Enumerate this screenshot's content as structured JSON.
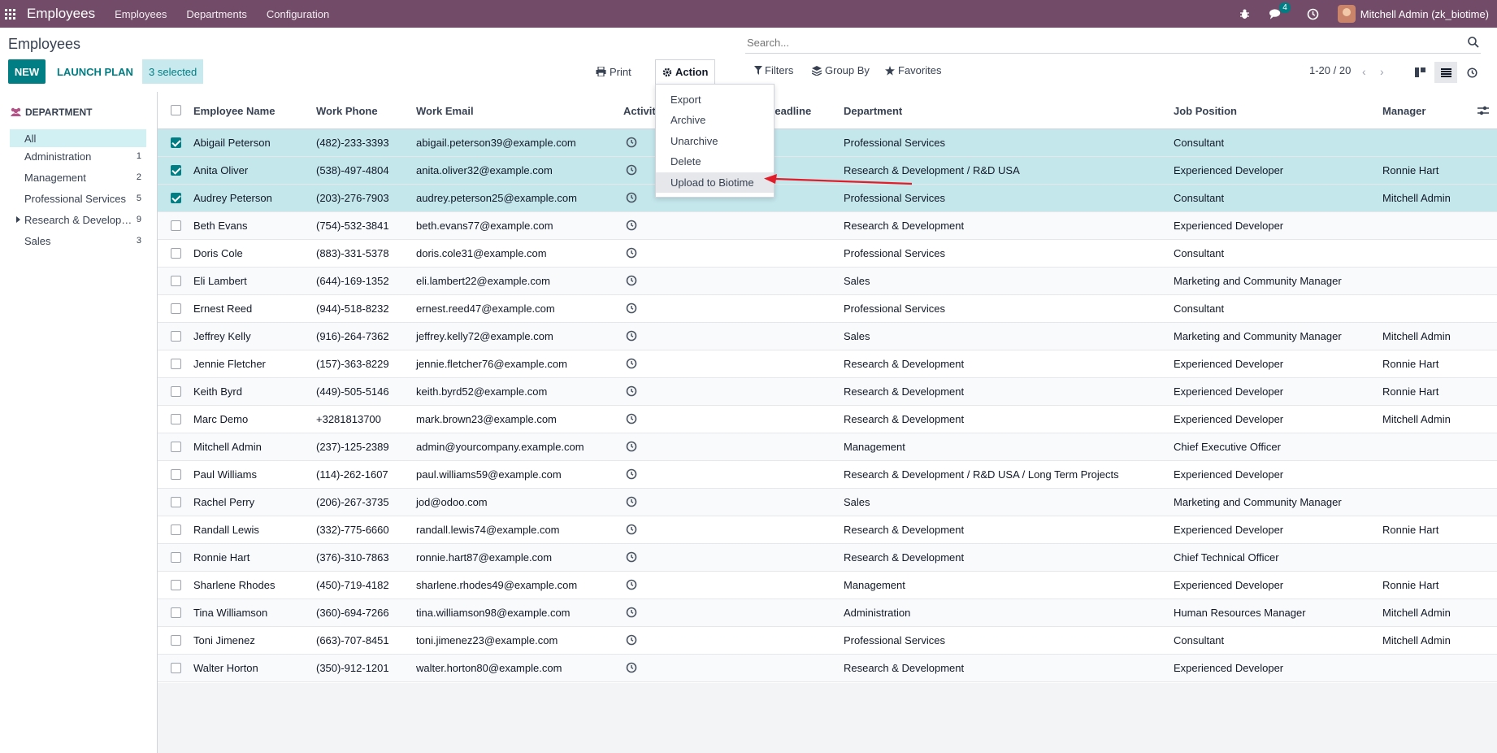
{
  "navbar": {
    "brand": "Employees",
    "menus": [
      "Employees",
      "Departments",
      "Configuration"
    ],
    "message_count": "4",
    "user": "Mitchell Admin (zk_biotime)"
  },
  "control": {
    "title": "Employees",
    "new_label": "NEW",
    "launch_label": "LAUNCH PLAN",
    "selected_label": "3 selected",
    "print_label": "Print",
    "action_label": "Action",
    "search_placeholder": "Search...",
    "filters_label": "Filters",
    "groupby_label": "Group By",
    "favorites_label": "Favorites",
    "pager": "1-20 / 20"
  },
  "action_menu": [
    "Export",
    "Archive",
    "Unarchive",
    "Delete",
    "Upload to Biotime"
  ],
  "sidebar": {
    "title": "DEPARTMENT",
    "items": [
      {
        "label": "All",
        "count": ""
      },
      {
        "label": "Administration",
        "count": "1"
      },
      {
        "label": "Management",
        "count": "2"
      },
      {
        "label": "Professional Services",
        "count": "5"
      },
      {
        "label": "Research & Development",
        "count": "9"
      },
      {
        "label": "Sales",
        "count": "3"
      }
    ]
  },
  "columns": [
    "Employee Name",
    "Work Phone",
    "Work Email",
    "Activities",
    "Deadline",
    "Department",
    "Job Position",
    "Manager"
  ],
  "rows": [
    {
      "name": "Abigail Peterson",
      "phone": "(482)-233-3393",
      "email": "abigail.peterson39@example.com",
      "dept": "Professional Services",
      "job": "Consultant",
      "manager": "",
      "selected": true
    },
    {
      "name": "Anita Oliver",
      "phone": "(538)-497-4804",
      "email": "anita.oliver32@example.com",
      "dept": "Research & Development / R&D USA",
      "job": "Experienced Developer",
      "manager": "Ronnie Hart",
      "selected": true
    },
    {
      "name": "Audrey Peterson",
      "phone": "(203)-276-7903",
      "email": "audrey.peterson25@example.com",
      "dept": "Professional Services",
      "job": "Consultant",
      "manager": "Mitchell Admin",
      "selected": true
    },
    {
      "name": "Beth Evans",
      "phone": "(754)-532-3841",
      "email": "beth.evans77@example.com",
      "dept": "Research & Development",
      "job": "Experienced Developer",
      "manager": "",
      "selected": false
    },
    {
      "name": "Doris Cole",
      "phone": "(883)-331-5378",
      "email": "doris.cole31@example.com",
      "dept": "Professional Services",
      "job": "Consultant",
      "manager": "",
      "selected": false
    },
    {
      "name": "Eli Lambert",
      "phone": "(644)-169-1352",
      "email": "eli.lambert22@example.com",
      "dept": "Sales",
      "job": "Marketing and Community Manager",
      "manager": "",
      "selected": false
    },
    {
      "name": "Ernest Reed",
      "phone": "(944)-518-8232",
      "email": "ernest.reed47@example.com",
      "dept": "Professional Services",
      "job": "Consultant",
      "manager": "",
      "selected": false
    },
    {
      "name": "Jeffrey Kelly",
      "phone": "(916)-264-7362",
      "email": "jeffrey.kelly72@example.com",
      "dept": "Sales",
      "job": "Marketing and Community Manager",
      "manager": "Mitchell Admin",
      "selected": false
    },
    {
      "name": "Jennie Fletcher",
      "phone": "(157)-363-8229",
      "email": "jennie.fletcher76@example.com",
      "dept": "Research & Development",
      "job": "Experienced Developer",
      "manager": "Ronnie Hart",
      "selected": false
    },
    {
      "name": "Keith Byrd",
      "phone": "(449)-505-5146",
      "email": "keith.byrd52@example.com",
      "dept": "Research & Development",
      "job": "Experienced Developer",
      "manager": "Ronnie Hart",
      "selected": false
    },
    {
      "name": "Marc Demo",
      "phone": "+3281813700",
      "email": "mark.brown23@example.com",
      "dept": "Research & Development",
      "job": "Experienced Developer",
      "manager": "Mitchell Admin",
      "selected": false
    },
    {
      "name": "Mitchell Admin",
      "phone": "(237)-125-2389",
      "email": "admin@yourcompany.example.com",
      "dept": "Management",
      "job": "Chief Executive Officer",
      "manager": "",
      "selected": false
    },
    {
      "name": "Paul Williams",
      "phone": "(114)-262-1607",
      "email": "paul.williams59@example.com",
      "dept": "Research & Development / R&D USA / Long Term Projects",
      "job": "Experienced Developer",
      "manager": "",
      "selected": false
    },
    {
      "name": "Rachel Perry",
      "phone": "(206)-267-3735",
      "email": "jod@odoo.com",
      "dept": "Sales",
      "job": "Marketing and Community Manager",
      "manager": "",
      "selected": false
    },
    {
      "name": "Randall Lewis",
      "phone": "(332)-775-6660",
      "email": "randall.lewis74@example.com",
      "dept": "Research & Development",
      "job": "Experienced Developer",
      "manager": "Ronnie Hart",
      "selected": false
    },
    {
      "name": "Ronnie Hart",
      "phone": "(376)-310-7863",
      "email": "ronnie.hart87@example.com",
      "dept": "Research & Development",
      "job": "Chief Technical Officer",
      "manager": "",
      "selected": false
    },
    {
      "name": "Sharlene Rhodes",
      "phone": "(450)-719-4182",
      "email": "sharlene.rhodes49@example.com",
      "dept": "Management",
      "job": "Experienced Developer",
      "manager": "Ronnie Hart",
      "selected": false
    },
    {
      "name": "Tina Williamson",
      "phone": "(360)-694-7266",
      "email": "tina.williamson98@example.com",
      "dept": "Administration",
      "job": "Human Resources Manager",
      "manager": "Mitchell Admin",
      "selected": false
    },
    {
      "name": "Toni Jimenez",
      "phone": "(663)-707-8451",
      "email": "toni.jimenez23@example.com",
      "dept": "Professional Services",
      "job": "Consultant",
      "manager": "Mitchell Admin",
      "selected": false
    },
    {
      "name": "Walter Horton",
      "phone": "(350)-912-1201",
      "email": "walter.horton80@example.com",
      "dept": "Research & Development",
      "job": "Experienced Developer",
      "manager": "",
      "selected": false
    }
  ],
  "colors": {
    "brand": "#714B67",
    "accent": "#017e84",
    "selected_row": "#c4e7ec",
    "annotation_arrow": "#e11d2a"
  }
}
